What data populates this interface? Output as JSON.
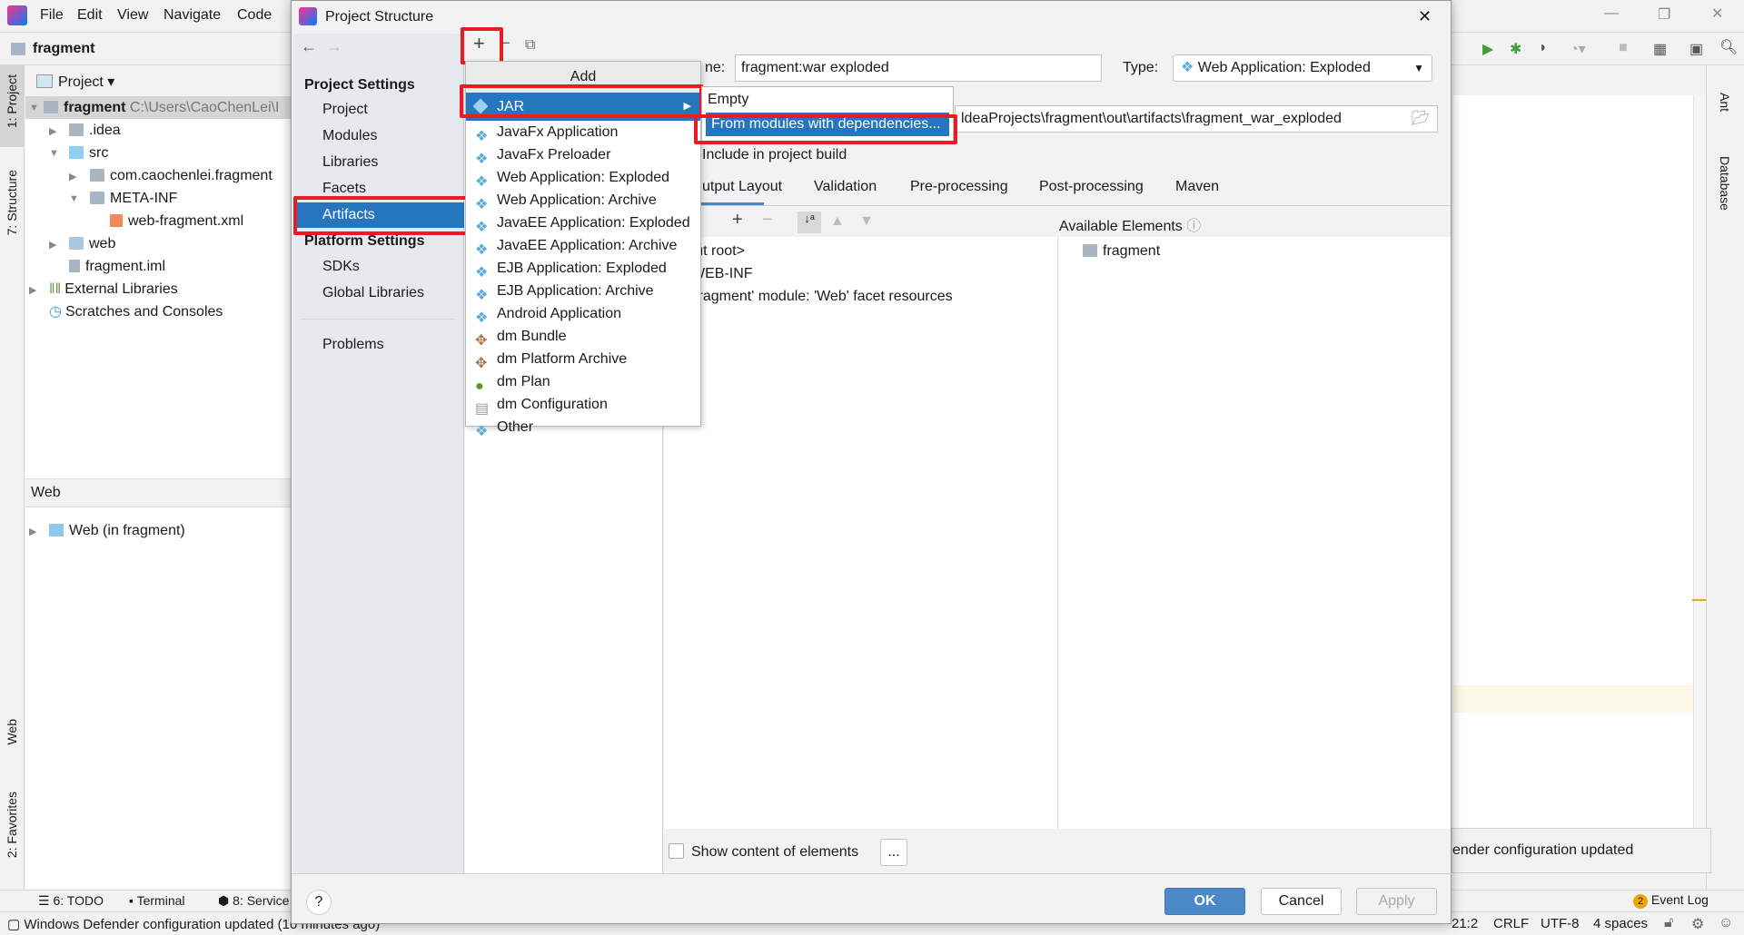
{
  "ide": {
    "menu": [
      "File",
      "Edit",
      "View",
      "Navigate",
      "Code"
    ],
    "project_name": "fragment",
    "project_dropdown": "Project",
    "left_tools": [
      "1: Project",
      "7: Structure",
      "Web",
      "2: Favorites"
    ],
    "right_tools": [
      "Ant",
      "Database"
    ],
    "tree": [
      {
        "label": "fragment",
        "path": "C:\\Users\\CaoChenLei\\I"
      },
      {
        "label": ".idea"
      },
      {
        "label": "src"
      },
      {
        "label": "com.caochenlei.fragment"
      },
      {
        "label": "META-INF"
      },
      {
        "label": "web-fragment.xml"
      },
      {
        "label": "web"
      },
      {
        "label": "fragment.iml"
      },
      {
        "label": "External Libraries"
      },
      {
        "label": "Scratches and Consoles"
      }
    ],
    "web_panel": {
      "title": "Web",
      "item": "Web (in fragment)"
    },
    "bottom_tools": [
      "6: TODO",
      "Terminal",
      "8: Service"
    ],
    "notification": "ender configuration updated",
    "event_log": {
      "count": "2",
      "label": "Event Log"
    },
    "status_message": "Windows Defender configuration updated (10 minutes ago)",
    "status_right": [
      "21:2",
      "CRLF",
      "UTF-8",
      "4 spaces"
    ]
  },
  "dialog": {
    "title": "Project Structure",
    "project_settings": "Project Settings",
    "project_items": [
      "Project",
      "Modules",
      "Libraries",
      "Facets",
      "Artifacts"
    ],
    "platform_settings": "Platform Settings",
    "platform_items": [
      "SDKs",
      "Global Libraries"
    ],
    "problems": "Problems",
    "add_menu": {
      "header": "Add",
      "items": [
        "JAR",
        "JavaFx Application",
        "JavaFx Preloader",
        "Web Application: Exploded",
        "Web Application: Archive",
        "JavaEE Application: Exploded",
        "JavaEE Application: Archive",
        "EJB Application: Exploded",
        "EJB Application: Archive",
        "Android Application",
        "dm Bundle",
        "dm Platform Archive",
        "dm Plan",
        "dm Configuration",
        "Other"
      ]
    },
    "jar_submenu": [
      "Empty",
      "From modules with dependencies..."
    ],
    "name_label": "ne:",
    "name_value": "fragment:war exploded",
    "type_label": "Type:",
    "type_value": "Web Application: Exploded",
    "output_dir": "ldeaProjects\\fragment\\out\\artifacts\\fragment_war_exploded",
    "include_build": "Include in project build",
    "tabs": [
      "utput Layout",
      "Validation",
      "Pre-processing",
      "Post-processing",
      "Maven"
    ],
    "layout_tree": [
      "utput root>",
      "WEB-INF",
      "'fragment' module: 'Web' facet resources"
    ],
    "available_elements": "Available Elements",
    "available_items": [
      "fragment"
    ],
    "show_content": "Show content of elements",
    "ellipsis": "...",
    "ok": "OK",
    "cancel": "Cancel",
    "apply": "Apply",
    "help": "?"
  },
  "colors": {
    "selection": "#2675bf",
    "highlight": "#e81c24",
    "ok_button": "#4a88c7"
  }
}
